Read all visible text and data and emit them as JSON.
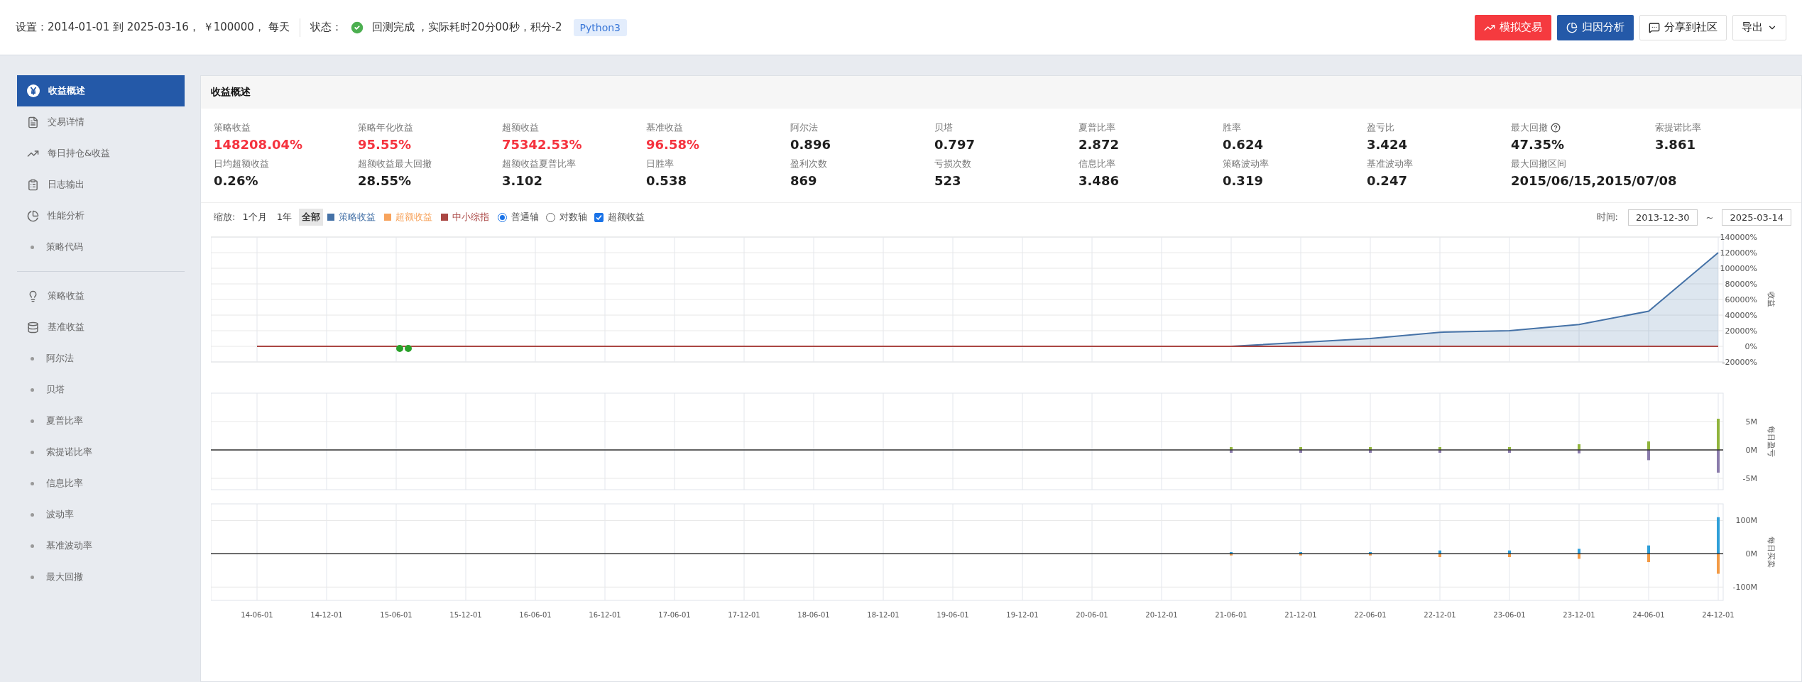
{
  "settings": {
    "label": "设置：",
    "value": "2014-01-01 到 2025-03-16， ￥100000， 每天"
  },
  "status": {
    "label": "状态：",
    "ok": true,
    "text": "回测完成 ，实际耗时20分00秒，积分-2",
    "tag": "Python3"
  },
  "actions": [
    {
      "label": "模拟交易",
      "kind": "danger"
    },
    {
      "label": "归因分析",
      "kind": "primary"
    },
    {
      "label": "分享到社区",
      "kind": "plain"
    },
    {
      "label": "导出",
      "kind": "dropdown"
    }
  ],
  "sidebar": {
    "groups": [
      [
        {
          "label": "收益概述",
          "kind": "icon",
          "selected": true
        },
        {
          "label": "交易详情",
          "kind": "icon",
          "selected": false
        },
        {
          "label": "每日持仓&收益",
          "kind": "icon",
          "selected": false
        },
        {
          "label": "日志输出",
          "kind": "icon",
          "selected": false
        },
        {
          "label": "性能分析",
          "kind": "icon",
          "selected": false
        },
        {
          "label": "策略代码",
          "kind": "bullet",
          "selected": false
        }
      ],
      [
        {
          "label": "策略收益",
          "kind": "icon",
          "selected": false
        },
        {
          "label": "基准收益",
          "kind": "icon",
          "selected": false
        },
        {
          "label": "阿尔法",
          "kind": "bullet",
          "selected": false
        },
        {
          "label": "贝塔",
          "kind": "bullet",
          "selected": false
        },
        {
          "label": "夏普比率",
          "kind": "bullet",
          "selected": false
        },
        {
          "label": "索提诺比率",
          "kind": "bullet",
          "selected": false
        },
        {
          "label": "信息比率",
          "kind": "bullet",
          "selected": false
        },
        {
          "label": "波动率",
          "kind": "bullet",
          "selected": false
        },
        {
          "label": "基准波动率",
          "kind": "bullet",
          "selected": false
        },
        {
          "label": "最大回撤",
          "kind": "bullet",
          "selected": false
        }
      ]
    ]
  },
  "panel": {
    "title": "收益概述",
    "metrics": [
      [
        {
          "label": "策略收益",
          "value": "148208.04%",
          "color": "#f5333f"
        },
        {
          "label": "策略年化收益",
          "value": "95.55%",
          "color": "#f5333f"
        },
        {
          "label": "超额收益",
          "value": "75342.53%",
          "color": "#f5333f"
        },
        {
          "label": "基准收益",
          "value": "96.58%",
          "color": "#f5333f"
        },
        {
          "label": "阿尔法",
          "value": "0.896",
          "color": "#1f1f1f"
        },
        {
          "label": "贝塔",
          "value": "0.797",
          "color": "#1f1f1f"
        },
        {
          "label": "夏普比率",
          "value": "2.872",
          "color": "#1f1f1f"
        },
        {
          "label": "胜率",
          "value": "0.624",
          "color": "#1f1f1f"
        },
        {
          "label": "盈亏比",
          "value": "3.424",
          "color": "#1f1f1f"
        },
        {
          "label": "最大回撤",
          "value": "47.35%",
          "color": "#1f1f1f",
          "help": true
        },
        {
          "label": "索提诺比率",
          "value": "3.861",
          "color": "#1f1f1f"
        }
      ],
      [
        {
          "label": "日均超额收益",
          "value": "0.26%",
          "color": "#1f1f1f"
        },
        {
          "label": "超额收益最大回撤",
          "value": "28.55%",
          "color": "#1f1f1f"
        },
        {
          "label": "超额收益夏普比率",
          "value": "3.102",
          "color": "#1f1f1f"
        },
        {
          "label": "日胜率",
          "value": "0.538",
          "color": "#1f1f1f"
        },
        {
          "label": "盈利次数",
          "value": "869",
          "color": "#1f1f1f"
        },
        {
          "label": "亏损次数",
          "value": "523",
          "color": "#1f1f1f"
        },
        {
          "label": "信息比率",
          "value": "3.486",
          "color": "#1f1f1f"
        },
        {
          "label": "策略波动率",
          "value": "0.319",
          "color": "#1f1f1f"
        },
        {
          "label": "基准波动率",
          "value": "0.247",
          "color": "#1f1f1f"
        },
        {
          "label": "最大回撤区间",
          "value": "2015/06/15,2015/07/08",
          "color": "#1f1f1f"
        }
      ]
    ],
    "toolbar": {
      "zoom_label": "缩放:",
      "zoom": [
        {
          "label": "1个月",
          "selected": false
        },
        {
          "label": "1年",
          "selected": false
        },
        {
          "label": "全部",
          "selected": true
        }
      ],
      "legend": [
        {
          "label": "策略收益",
          "color": "#4572a7"
        },
        {
          "label": "超额收益",
          "color": "#f7a35c"
        },
        {
          "label": "中小综指",
          "color": "#aa4643"
        }
      ],
      "axis": [
        {
          "label": "普通轴",
          "selected": true
        },
        {
          "label": "对数轴",
          "selected": false
        }
      ],
      "excess": {
        "label": "超额收益",
        "checked": true
      },
      "time_label": "时间:",
      "start": "2013-12-30",
      "separator": "~",
      "end": "2025-03-14"
    },
    "charts": [
      {
        "chart_data": {
          "type": "area",
          "ylabel": "收益",
          "grid": true,
          "series": [
            {
              "color": "#4572a7",
              "type": "area",
              "values": [
                0,
                0,
                0,
                0,
                0,
                0,
                0,
                0,
                0,
                0,
                0,
                0,
                0,
                0,
                0,
                5000,
                10000,
                18000,
                20000,
                28000,
                45000,
                120000
              ]
            },
            {
              "color": "#aa4643",
              "type": "line",
              "values": [
                0,
                0,
                0,
                0,
                0,
                0,
                0,
                0,
                0,
                0,
                0,
                0,
                0,
                0,
                0,
                0,
                0,
                0,
                0,
                0,
                0,
                0
              ]
            }
          ],
          "ylim": [
            -20000,
            140000
          ],
          "yticks": [
            {
              "value": -20000,
              "label": "-20000%"
            },
            {
              "value": 0,
              "label": "0%"
            },
            {
              "value": 20000,
              "label": "20000%"
            },
            {
              "value": 40000,
              "label": "40000%"
            },
            {
              "value": 60000,
              "label": "60000%"
            },
            {
              "value": 80000,
              "label": "80000%"
            },
            {
              "value": 100000,
              "label": "100000%"
            },
            {
              "value": 120000,
              "label": "120000%"
            },
            {
              "value": 140000,
              "label": "140000%"
            }
          ]
        }
      },
      {
        "chart_data": {
          "type": "bar",
          "ylabel": "每日盈亏",
          "grid": true,
          "series": [
            {
              "color": "#90b43c",
              "values": [
                0,
                0,
                0,
                0,
                0,
                0,
                0,
                0,
                0,
                0,
                0,
                0,
                0,
                0,
                0.5,
                0.5,
                0.5,
                0.5,
                0.5,
                1,
                1.5,
                5.5
              ]
            },
            {
              "color": "#8a7bab",
              "values": [
                0,
                0,
                0,
                0,
                0,
                0,
                0,
                0,
                0,
                0,
                0,
                0,
                0,
                0,
                -0.5,
                -0.5,
                -0.5,
                -0.5,
                -0.5,
                -0.6,
                -1.8,
                -4
              ]
            }
          ],
          "ylim": [
            -7,
            10
          ],
          "stacked": true,
          "yticks": [
            {
              "value": -5,
              "label": "-5M"
            },
            {
              "value": 0,
              "label": "0M"
            },
            {
              "value": 5,
              "label": "5M"
            }
          ]
        }
      },
      {
        "chart_data": {
          "type": "bar",
          "ylabel": "每日买卖",
          "grid": true,
          "categories": [
            "14-06-01",
            "14-12-01",
            "15-06-01",
            "15-12-01",
            "16-06-01",
            "16-12-01",
            "17-06-01",
            "17-12-01",
            "18-06-01",
            "18-12-01",
            "19-06-01",
            "19-12-01",
            "20-06-01",
            "20-12-01",
            "21-06-01",
            "21-12-01",
            "22-06-01",
            "22-12-01",
            "23-06-01",
            "23-12-01",
            "24-06-01",
            "24-12-01"
          ],
          "series": [
            {
              "color": "#2f9fd8",
              "values": [
                0,
                0,
                0,
                0,
                0,
                0,
                0,
                0,
                0,
                0,
                0,
                0,
                0,
                0,
                5,
                5,
                5,
                10,
                10,
                15,
                25,
                110
              ]
            },
            {
              "color": "#f39a45",
              "values": [
                0,
                0,
                0,
                0,
                0,
                0,
                0,
                0,
                0,
                0,
                0,
                0,
                0,
                0,
                -5,
                -5,
                -5,
                -10,
                -10,
                -15,
                -25,
                -60
              ]
            }
          ],
          "ylim": [
            -140,
            150
          ],
          "stacked": true,
          "yticks": [
            {
              "value": -100,
              "label": "-100M"
            },
            {
              "value": 0,
              "label": "0M"
            },
            {
              "value": 100,
              "label": "100M"
            }
          ]
        }
      }
    ]
  }
}
